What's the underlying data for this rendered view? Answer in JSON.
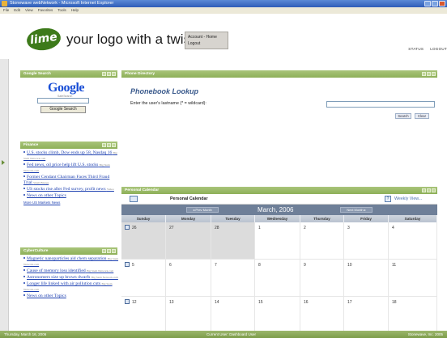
{
  "window": {
    "title": "Stonewave webNetwork - Microsoft Internet Explorer"
  },
  "menubar": {
    "items": [
      "File",
      "Edit",
      "View",
      "Favorites",
      "Tools",
      "Help"
    ]
  },
  "header": {
    "logo_mark": "lime",
    "logo_text": "your logo with a twist",
    "account_link": "Account",
    "home_link": "Home",
    "logout_link": "Logout",
    "status_link": "STATUS",
    "logout_right": "LOGOUT"
  },
  "google": {
    "portlet_title": "Google Search",
    "logo": "Google",
    "logo_sub": "SafeSearch",
    "search_button": "Google Search"
  },
  "finance": {
    "portlet_title": "Finance",
    "items": [
      {
        "text": "U.S. stocks climb, Dow ends up 58, Nasdaq 16",
        "source": "Big Stem Network.com"
      },
      {
        "text": "Fed news, oil price help lift U.S. stocks",
        "source": "Big Stem Network.com"
      },
      {
        "text": "Former Cendant Chairman Faces Third Fraud Trial",
        "source": "Small Blunge"
      },
      {
        "text": "US stocks rise after Fed survey, profit news",
        "source": "Yahoo"
      },
      {
        "text": "News on other Topics",
        "source": ""
      }
    ],
    "more": "More US Markets News"
  },
  "cyberculture": {
    "portlet_title": "CyberCulture",
    "items": [
      {
        "text": "Magnetic nanoparticles aid chem separation",
        "source": "Big Stem Network.com"
      },
      {
        "text": "Cause of memory loss identified",
        "source": "Big Stem Network.com"
      },
      {
        "text": "Astronomers size up brown dwarfs",
        "source": "Big Stem Network.com"
      },
      {
        "text": "Longer life linked with air pollution cuts",
        "source": "Big Stem Network.com"
      },
      {
        "text": "News on other Topics",
        "source": ""
      }
    ]
  },
  "phonebook": {
    "portlet_title": "Phone Directory",
    "title": "Phonebook Lookup",
    "label": "Enter the user's lastname (* = wildcard):",
    "search_button": "Search",
    "clear_button": "Clear"
  },
  "calendar": {
    "portlet_title": "Personal Calendar",
    "title": "Personal Calendar",
    "weekly_link": "Weekly View...",
    "prev_button": "Prev Month",
    "next_button": "Next Month",
    "month": "March, 2006",
    "weekdays": [
      "Sunday",
      "Monday",
      "Tuesday",
      "Wednesday",
      "Thursday",
      "Friday",
      "Saturday"
    ],
    "rows": [
      [
        "26",
        "27",
        "28",
        "1",
        "2",
        "3",
        "4"
      ],
      [
        "5",
        "6",
        "7",
        "8",
        "9",
        "10",
        "11"
      ],
      [
        "12",
        "13",
        "14",
        "15",
        "16",
        "17",
        "18"
      ]
    ]
  },
  "statusbar": {
    "date": "Thursday, March 16, 2006",
    "user": "Current User: Dashboard User",
    "copyright": "Stonewave, Inc. 2005"
  }
}
